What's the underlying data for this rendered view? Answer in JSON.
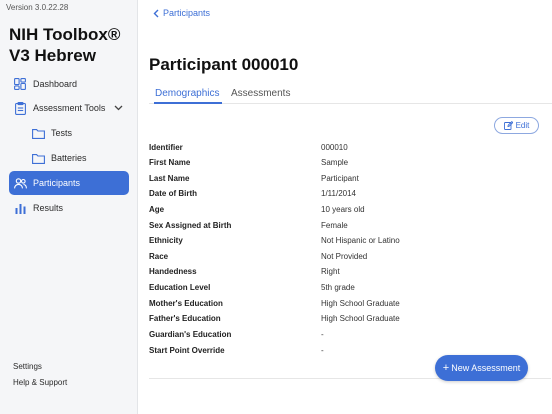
{
  "app": {
    "version": "Version 3.0.22.28",
    "title_line1": "NIH Toolbox®",
    "title_line2": "V3 Hebrew"
  },
  "sidebar": {
    "items": [
      {
        "label": "Dashboard",
        "icon": "dashboard-icon"
      },
      {
        "label": "Assessment Tools",
        "icon": "clipboard-icon"
      },
      {
        "label": "Tests",
        "icon": "folder-icon"
      },
      {
        "label": "Batteries",
        "icon": "folder-icon"
      },
      {
        "label": "Participants",
        "icon": "people-icon",
        "active": true
      },
      {
        "label": "Results",
        "icon": "bar-chart-icon"
      }
    ],
    "footer": {
      "settings": "Settings",
      "help": "Help & Support"
    }
  },
  "header": {
    "back_label": "Participants",
    "title": "Participant 000010"
  },
  "tabs": [
    {
      "label": "Demographics",
      "active": true
    },
    {
      "label": "Assessments",
      "active": false
    }
  ],
  "edit_label": "Edit",
  "fields": [
    {
      "label": "Identifier",
      "value": "000010"
    },
    {
      "label": "First Name",
      "value": "Sample"
    },
    {
      "label": "Last Name",
      "value": "Participant"
    },
    {
      "label": "Date of Birth",
      "value": "1/11/2014"
    },
    {
      "label": "Age",
      "value": "10 years old"
    },
    {
      "label": "Sex Assigned at Birth",
      "value": "Female"
    },
    {
      "label": "Ethnicity",
      "value": "Not Hispanic or Latino"
    },
    {
      "label": "Race",
      "value": "Not Provided"
    },
    {
      "label": "Handedness",
      "value": "Right"
    },
    {
      "label": "Education Level",
      "value": "5th grade"
    },
    {
      "label": "Mother's Education",
      "value": "High School Graduate"
    },
    {
      "label": "Father's Education",
      "value": "High School Graduate"
    },
    {
      "label": "Guardian's Education",
      "value": "-"
    },
    {
      "label": "Start Point Override",
      "value": "-"
    }
  ],
  "fab": {
    "plus": "+",
    "label": "New Assessment"
  },
  "colors": {
    "accent": "#3d6fd6",
    "sidebar_bg": "#f5f6f8"
  }
}
